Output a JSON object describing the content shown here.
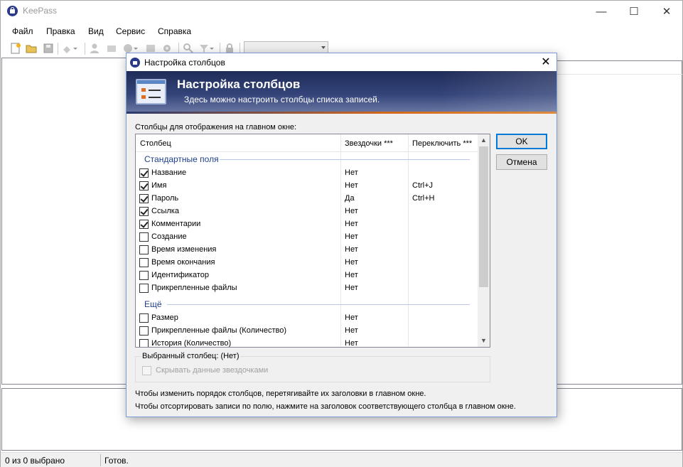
{
  "app": {
    "title": "KeePass",
    "controls": {
      "minimize": "—",
      "maximize": "☐",
      "close": "✕"
    }
  },
  "menu": [
    "Файл",
    "Правка",
    "Вид",
    "Сервис",
    "Справка"
  ],
  "toolbar": {
    "icons": [
      "new-database-icon",
      "open-database-icon",
      "save-icon",
      "add-entry-icon",
      "user-copy-icon",
      "password-copy-icon",
      "url-icon",
      "autotype-icon",
      "settings-icon",
      "search-icon",
      "filter-icon",
      "lock-icon"
    ],
    "quick_find_value": ""
  },
  "status": {
    "selection": "0 из 0 выбрано",
    "state": "Готов."
  },
  "dialog": {
    "title": "Настройка столбцов",
    "close": "✕",
    "banner_title": "Настройка столбцов",
    "banner_subtitle": "Здесь можно настроить столбцы списка записей.",
    "list_label": "Столбцы для отображения на главном окне:",
    "columns": {
      "column": "Столбец",
      "stars": "Звездочки ***",
      "toggle": "Переключить ***"
    },
    "groups": [
      {
        "label": "Стандартные поля",
        "rows": [
          {
            "name": "Название",
            "checked": true,
            "stars": "Нет",
            "toggle": ""
          },
          {
            "name": "Имя",
            "checked": true,
            "stars": "Нет",
            "toggle": "Ctrl+J"
          },
          {
            "name": "Пароль",
            "checked": true,
            "stars": "Да",
            "toggle": "Ctrl+H"
          },
          {
            "name": "Ссылка",
            "checked": true,
            "stars": "Нет",
            "toggle": ""
          },
          {
            "name": "Комментарии",
            "checked": true,
            "stars": "Нет",
            "toggle": ""
          },
          {
            "name": "Создание",
            "checked": false,
            "stars": "Нет",
            "toggle": ""
          },
          {
            "name": "Время изменения",
            "checked": false,
            "stars": "Нет",
            "toggle": ""
          },
          {
            "name": "Время окончания",
            "checked": false,
            "stars": "Нет",
            "toggle": ""
          },
          {
            "name": "Идентификатор",
            "checked": false,
            "stars": "Нет",
            "toggle": ""
          },
          {
            "name": "Прикрепленные файлы",
            "checked": false,
            "stars": "Нет",
            "toggle": ""
          }
        ]
      },
      {
        "label": "Ещё",
        "rows": [
          {
            "name": "Размер",
            "checked": false,
            "stars": "Нет",
            "toggle": ""
          },
          {
            "name": "Прикрепленные файлы (Количество)",
            "checked": false,
            "stars": "Нет",
            "toggle": ""
          },
          {
            "name": "История (Количество)",
            "checked": false,
            "stars": "Нет",
            "toggle": ""
          }
        ]
      }
    ],
    "ok_label": "OK",
    "cancel_label": "Отмена",
    "selected_column": "Выбранный столбец: (Нет)",
    "hide_stars_label": "Скрывать данные звездочками",
    "hint_reorder": "Чтобы изменить порядок столбцов, перетягивайте их заголовки в главном окне.",
    "hint_sort": "Чтобы отсортировать записи по полю, нажмите на заголовок соответствующего столбца в главном окне."
  }
}
